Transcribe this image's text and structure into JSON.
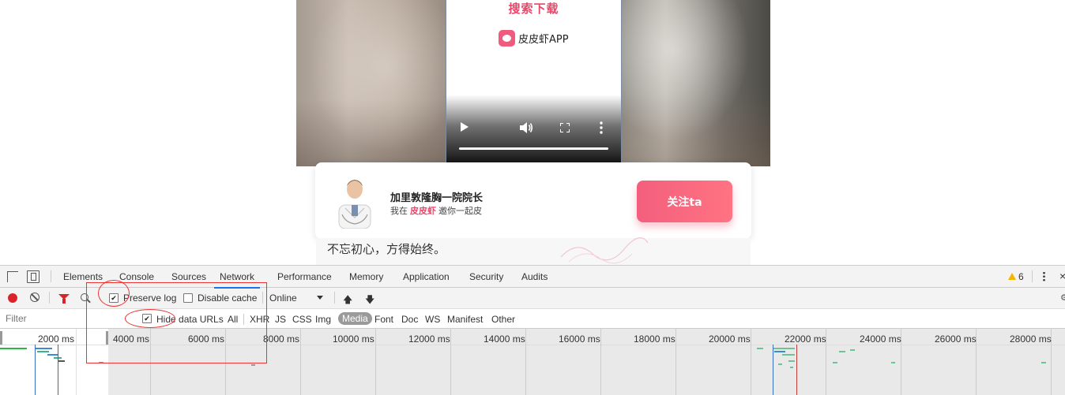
{
  "page": {
    "video": {
      "title": "搜索下载",
      "app_name": "皮皮虾APP"
    },
    "card": {
      "name": "加里敦隆胸一院院长",
      "sub_prefix": "我在",
      "sub_brand": "皮皮虾",
      "sub_suffix": "邀你一起皮",
      "follow_label": "关注ta"
    },
    "motto": "不忘初心，方得始终。"
  },
  "devtools": {
    "tabs": [
      "Elements",
      "Console",
      "Sources",
      "Network",
      "Performance",
      "Memory",
      "Application",
      "Security",
      "Audits"
    ],
    "active_tab": "Network",
    "warnings": "6",
    "toolbar": {
      "preserve_log": "Preserve log",
      "preserve_log_checked": true,
      "disable_cache": "Disable cache",
      "disable_cache_checked": false,
      "throttling": "Online"
    },
    "filter": {
      "placeholder": "Filter",
      "hide_data_urls": "Hide data URLs",
      "hide_data_urls_checked": true,
      "types": [
        "All",
        "XHR",
        "JS",
        "CSS",
        "Img",
        "Media",
        "Font",
        "Doc",
        "WS",
        "Manifest",
        "Other"
      ],
      "active_type": "Media"
    },
    "timeline": {
      "ticks": [
        "2000 ms",
        "4000 ms",
        "6000 ms",
        "8000 ms",
        "10000 ms",
        "12000 ms",
        "14000 ms",
        "16000 ms",
        "18000 ms",
        "20000 ms",
        "22000 ms",
        "24000 ms",
        "26000 ms",
        "28000 ms"
      ]
    }
  },
  "colors": {
    "brand_pink": "#e8476a",
    "record_red": "#d9232b",
    "active_tab_blue": "#1a73e8",
    "annotation_red": "#e33"
  }
}
